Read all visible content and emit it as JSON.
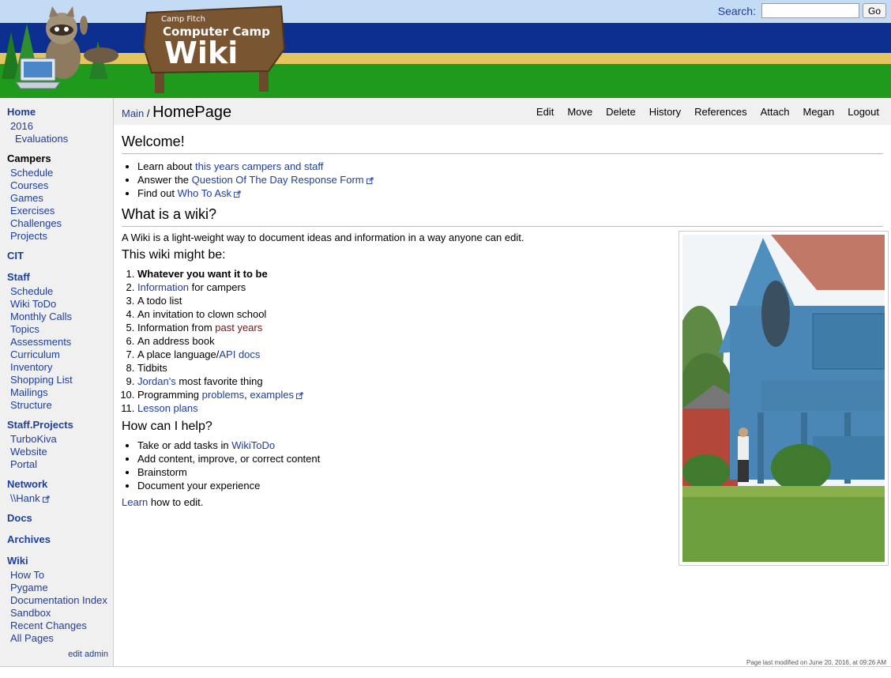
{
  "header": {
    "logo": {
      "small": "Camp Fitch",
      "mid": "Computer Camp",
      "big": "Wiki"
    },
    "search_label": "Search:",
    "search_value": "",
    "go_label": "Go"
  },
  "sidebar": {
    "home": "Home",
    "home_items": [
      "2016",
      "Evaluations"
    ],
    "campers": "Campers",
    "campers_items": [
      "Schedule",
      "Courses",
      "Games",
      "Exercises",
      "Challenges",
      "Projects"
    ],
    "cit": "CIT",
    "staff": "Staff",
    "staff_items": [
      "Schedule",
      "Wiki ToDo",
      "Monthly Calls",
      "Topics",
      "Assessments",
      "Curriculum",
      "Inventory",
      "Shopping List",
      "Mailings",
      "Structure"
    ],
    "staff_projects": "Staff.Projects",
    "staff_projects_items": [
      "TurboKiva",
      "Website",
      "Portal"
    ],
    "network": "Network",
    "network_items": [
      "\\\\Hank"
    ],
    "docs": "Docs",
    "archives": "Archives",
    "wiki": "Wiki",
    "wiki_items": [
      "How To",
      "Pygame",
      "Documentation Index",
      "Sandbox",
      "Recent Changes",
      "All Pages"
    ],
    "edit_admin": "edit admin"
  },
  "pagehead": {
    "crumb": "Main",
    "slash": "/",
    "title": "HomePage",
    "actions": [
      "Edit",
      "Move",
      "Delete",
      "History",
      "References",
      "Attach",
      "Megan",
      "Logout"
    ]
  },
  "content": {
    "welcome_heading": "Welcome!",
    "welcome_items": [
      {
        "pre": "Learn about ",
        "link": "this years campers and staff"
      },
      {
        "pre": "Answer the ",
        "link": "Question Of The Day Response Form"
      },
      {
        "pre": "Find out ",
        "link": "Who To Ask"
      }
    ],
    "wiki_heading": "What is a wiki?",
    "wiki_intro": "A Wiki is a light-weight way to document ideas and information in a way anyone can edit.",
    "might_heading": "This wiki might be:",
    "might_items": {
      "i1": "Whatever you want it to be",
      "i2_link": "Information",
      "i2_post": " for campers",
      "i3": "A todo list",
      "i4": "An invitation to clown school",
      "i5_pre": "Information from ",
      "i5_link": "past years",
      "i6": "An address book",
      "i7_pre": "A place language/",
      "i7_link": "API docs",
      "i8": "Tidbits",
      "i9_link": "Jordan's",
      "i9_post": " most favorite thing",
      "i10_pre": "Programming ",
      "i10_link1": "problems",
      "i10_sep": ", ",
      "i10_link2": "examples",
      "i11_link": "Lesson plans"
    },
    "help_heading": "How can I help?",
    "help_items": {
      "h1_pre": "Take or add tasks in ",
      "h1_link": "WikiToDo",
      "h2": "Add content, improve, or correct content",
      "h3": "Brainstorm",
      "h4": "Document your experience"
    },
    "learn_link": "Learn",
    "learn_post": " how to edit."
  },
  "footer": "Page last modified on June 20, 2016, at 09:26 AM"
}
